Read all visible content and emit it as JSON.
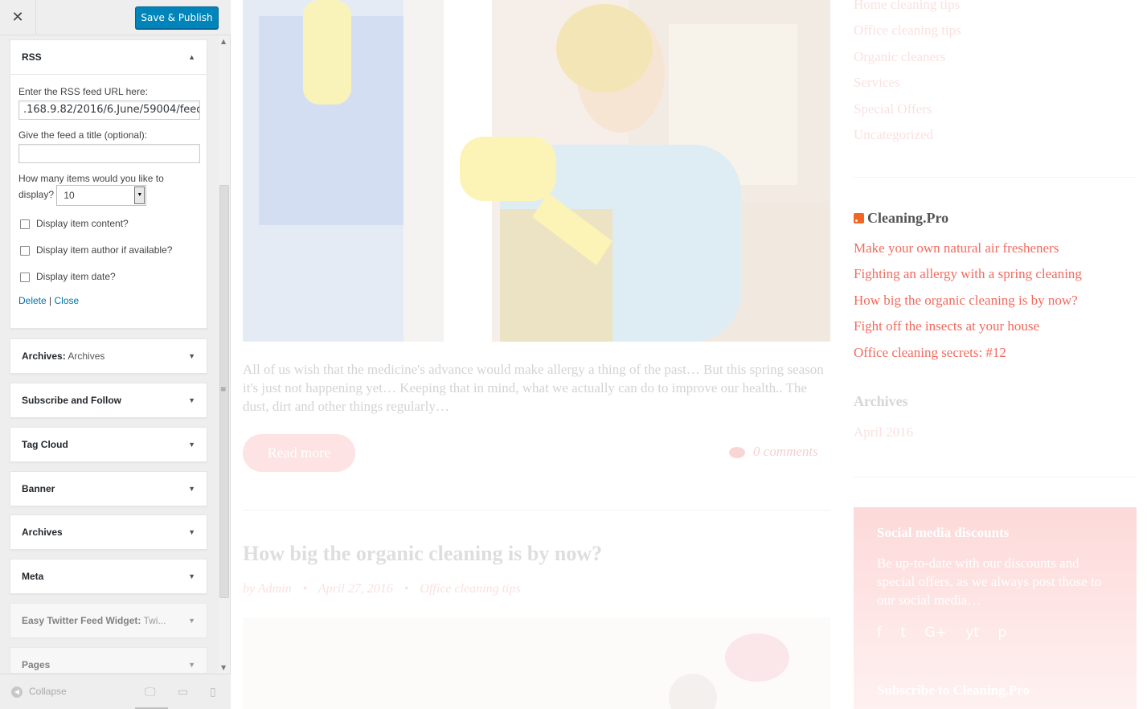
{
  "customizer": {
    "close_label": "✕",
    "save_label": "Save & Publish",
    "rss_widget": {
      "title": "RSS",
      "url_label": "Enter the RSS feed URL here:",
      "url_value": ".168.9.82/2016/6.June/59004/feed",
      "title_label": "Give the feed a title (optional):",
      "title_value": "",
      "count_label_1": "How many items would you like to",
      "count_label_2": "display?",
      "count_value": "10",
      "opt_content": "Display item content?",
      "opt_author": "Display item author if available?",
      "opt_date": "Display item date?",
      "delete_label": "Delete",
      "separator": "|",
      "close_label": "Close"
    },
    "widgets": [
      {
        "title": "Archives:",
        "sub": " Archives"
      },
      {
        "title": "Subscribe and Follow",
        "sub": ""
      },
      {
        "title": "Tag Cloud",
        "sub": ""
      },
      {
        "title": "Banner",
        "sub": ""
      },
      {
        "title": "Archives",
        "sub": ""
      },
      {
        "title": "Meta",
        "sub": ""
      },
      {
        "title": "Easy Twitter Feed Widget:",
        "sub": " Twi..."
      },
      {
        "title": "Pages",
        "sub": ""
      }
    ],
    "collapse_label": "Collapse"
  },
  "preview": {
    "excerpt": "All of us wish that the medicine's advance would make allergy a thing of the past… But this spring season it's just not happening yet… Keeping that in mind, what we actually can do to improve our health.. The dust, dirt and other things regularly…",
    "read_more": "Read more",
    "comments": "0 comments",
    "post_title": "How big the organic cleaning is by now?",
    "meta_author": "by Admin",
    "meta_dot": "•",
    "meta_date": "April 27, 2016",
    "meta_category": "Office cleaning tips",
    "categories": [
      "Home cleaning tips",
      "Office cleaning tips",
      "Organic cleaners",
      "Services",
      "Special Offers",
      "Uncategorized"
    ],
    "rss_title": "Cleaning.Pro",
    "feed_items": [
      "Make your own natural air fresheners",
      "Fighting an allergy with a spring cleaning",
      "How big the organic cleaning is by now?",
      "Fight off the insects at your house",
      "Office cleaning secrets: #12"
    ],
    "archives_title": "Archives",
    "archives_item": "April 2016",
    "promo_title": "Social media discounts",
    "promo_text": "Be up-to-date with our discounts and special offers, as we always post those to our social media…",
    "promo_subscribe": "Subscribe to Cleaning.Pro",
    "social_icons": [
      "f",
      "t",
      "G+",
      "yt",
      "p"
    ]
  },
  "colors": {
    "accent": "#f26a5f",
    "button_blue": "#0085ba"
  }
}
